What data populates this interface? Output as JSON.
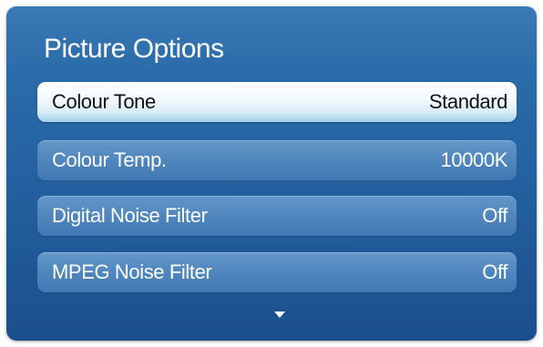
{
  "window": {
    "title": "Picture Options"
  },
  "menu": {
    "items": [
      {
        "label": "Colour Tone",
        "value": "Standard",
        "selected": true
      },
      {
        "label": "Colour Temp.",
        "value": "10000K",
        "selected": false
      },
      {
        "label": "Digital Noise Filter",
        "value": "Off",
        "selected": false
      },
      {
        "label": "MPEG Noise Filter",
        "value": "Off",
        "selected": false
      }
    ]
  },
  "icons": {
    "scroll_down": "triangle-down-icon"
  },
  "colors": {
    "panel": "#2563a2",
    "item": "#4f86bd",
    "selected_item": "#d9ecf6",
    "text": "#ffffff",
    "selected_text": "#111111"
  }
}
